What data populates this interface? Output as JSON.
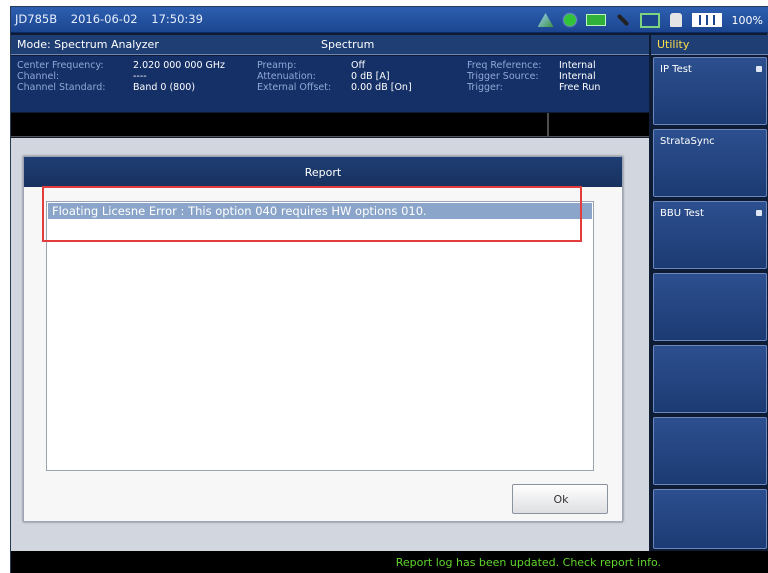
{
  "status_bar": {
    "device_id": "JD785B",
    "date": "2016-06-02",
    "time": "17:50:39",
    "battery": "100%",
    "icons": [
      "signal-icon",
      "gps-icon",
      "wifi-icon",
      "pen-icon",
      "network-icon",
      "power-plug-icon",
      "battery-icon"
    ]
  },
  "mode_bar": {
    "mode_label": "Mode: Spectrum Analyzer",
    "title": "Spectrum"
  },
  "info_panel": {
    "center_frequency_label": "Center Frequency:",
    "center_frequency_value": "2.020 000 000 GHz",
    "channel_label": "Channel:",
    "channel_value": "----",
    "channel_standard_label": "Channel Standard:",
    "channel_standard_value": "Band 0 (800)",
    "preamp_label": "Preamp:",
    "preamp_value": "Off",
    "attenuation_label": "Attenuation:",
    "attenuation_value": "0 dB [A]",
    "external_offset_label": "External Offset:",
    "external_offset_value": "0.00 dB [On]",
    "freq_reference_label": "Freq Reference:",
    "freq_reference_value": "Internal",
    "trigger_source_label": "Trigger Source:",
    "trigger_source_value": "Internal",
    "trigger_label": "Trigger:",
    "trigger_value": "Free Run"
  },
  "softkeys": {
    "header": "Utility",
    "items": [
      {
        "label": "IP Test"
      },
      {
        "label": "StrataSync"
      },
      {
        "label": "BBU Test"
      },
      {
        "label": ""
      },
      {
        "label": ""
      },
      {
        "label": ""
      },
      {
        "label": ""
      }
    ]
  },
  "dialog": {
    "title": "Report",
    "rows": [
      "Floating Licesne Error : This option 040 requires HW options 010."
    ],
    "ok_label": "Ok"
  },
  "bottom_bar": {
    "message": "Report log has been updated. Check report info."
  },
  "colors": {
    "highlight": "#e23c3c",
    "accent": "#ffdf4a",
    "status_message": "#5fd62b"
  }
}
